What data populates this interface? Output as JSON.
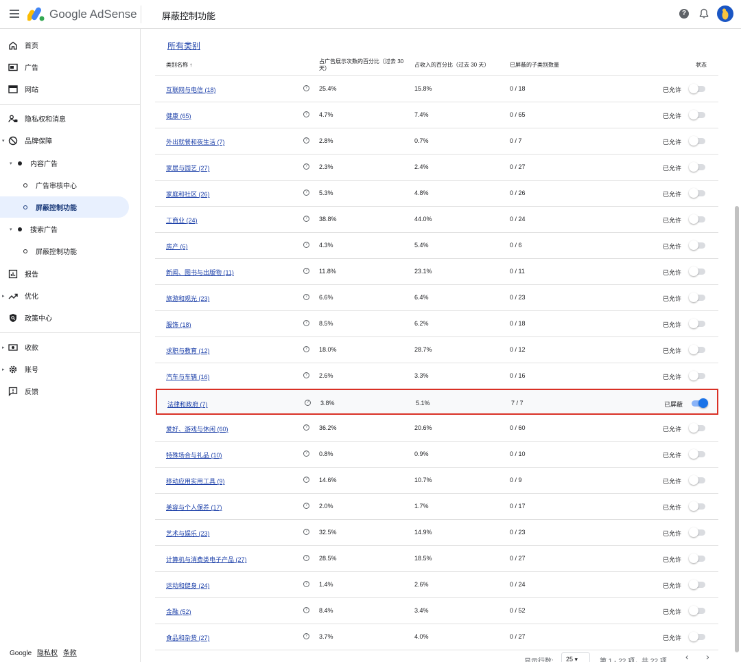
{
  "app": {
    "brand": "Google AdSense",
    "page_title": "屏蔽控制功能"
  },
  "header": {
    "help_label": "?"
  },
  "sidebar": {
    "items": [
      {
        "label": "首页"
      },
      {
        "label": "广告"
      },
      {
        "label": "网站"
      },
      {
        "label": "隐私权和消息"
      },
      {
        "label": "品牌保障"
      },
      {
        "label": "内容广告"
      },
      {
        "label": "广告审核中心"
      },
      {
        "label": "屏蔽控制功能"
      },
      {
        "label": "搜索广告"
      },
      {
        "label": "屏蔽控制功能"
      },
      {
        "label": "报告"
      },
      {
        "label": "优化"
      },
      {
        "label": "政策中心"
      },
      {
        "label": "收款"
      },
      {
        "label": "账号"
      },
      {
        "label": "反馈"
      }
    ],
    "footer": {
      "google": "Google",
      "privacy": "隐私权",
      "terms": "条款"
    }
  },
  "main": {
    "section_link": "所有类别",
    "columns": {
      "name": "类别名称 ↑",
      "impressions_line1": "占广告展示次数的百分比（过去 30",
      "impressions_line2": "天）",
      "revenue": "占收入的百分比（过去 30 天）",
      "blocked_subcats": "已屏蔽的子类别数量",
      "status": "状态"
    },
    "rows": [
      {
        "name": "互联网与电信 (18)",
        "impressions": "25.4%",
        "revenue": "15.8%",
        "blocked": "0 / 18",
        "status": "已允许",
        "on": false
      },
      {
        "name": "健康 (65)",
        "impressions": "4.7%",
        "revenue": "7.4%",
        "blocked": "0 / 65",
        "status": "已允许",
        "on": false
      },
      {
        "name": "外出就餐和夜生活 (7)",
        "impressions": "2.8%",
        "revenue": "0.7%",
        "blocked": "0 / 7",
        "status": "已允许",
        "on": false
      },
      {
        "name": "家居与园艺 (27)",
        "impressions": "2.3%",
        "revenue": "2.4%",
        "blocked": "0 / 27",
        "status": "已允许",
        "on": false
      },
      {
        "name": "家庭和社区 (26)",
        "impressions": "5.3%",
        "revenue": "4.8%",
        "blocked": "0 / 26",
        "status": "已允许",
        "on": false
      },
      {
        "name": "工商业 (24)",
        "impressions": "38.8%",
        "revenue": "44.0%",
        "blocked": "0 / 24",
        "status": "已允许",
        "on": false
      },
      {
        "name": "房产 (6)",
        "impressions": "4.3%",
        "revenue": "5.4%",
        "blocked": "0 / 6",
        "status": "已允许",
        "on": false
      },
      {
        "name": "新闻、图书与出版物 (11)",
        "impressions": "11.8%",
        "revenue": "23.1%",
        "blocked": "0 / 11",
        "status": "已允许",
        "on": false
      },
      {
        "name": "旅游和观光 (23)",
        "impressions": "6.6%",
        "revenue": "6.4%",
        "blocked": "0 / 23",
        "status": "已允许",
        "on": false
      },
      {
        "name": "服饰 (18)",
        "impressions": "8.5%",
        "revenue": "6.2%",
        "blocked": "0 / 18",
        "status": "已允许",
        "on": false
      },
      {
        "name": "求职与教育 (12)",
        "impressions": "18.0%",
        "revenue": "28.7%",
        "blocked": "0 / 12",
        "status": "已允许",
        "on": false
      },
      {
        "name": "汽车与车辆 (16)",
        "impressions": "2.6%",
        "revenue": "3.3%",
        "blocked": "0 / 16",
        "status": "已允许",
        "on": false
      },
      {
        "name": "法律和政府 (7)",
        "impressions": "3.8%",
        "revenue": "5.1%",
        "blocked": "7 / 7",
        "status": "已屏蔽",
        "on": true
      },
      {
        "name": "爱好、游戏与休闲 (60)",
        "impressions": "36.2%",
        "revenue": "20.6%",
        "blocked": "0 / 60",
        "status": "已允许",
        "on": false
      },
      {
        "name": "特殊场合与礼品 (10)",
        "impressions": "0.8%",
        "revenue": "0.9%",
        "blocked": "0 / 10",
        "status": "已允许",
        "on": false
      },
      {
        "name": "移动应用实用工具 (9)",
        "impressions": "14.6%",
        "revenue": "10.7%",
        "blocked": "0 / 9",
        "status": "已允许",
        "on": false
      },
      {
        "name": "美容与个人保养 (17)",
        "impressions": "2.0%",
        "revenue": "1.7%",
        "blocked": "0 / 17",
        "status": "已允许",
        "on": false
      },
      {
        "name": "艺术与娱乐 (23)",
        "impressions": "32.5%",
        "revenue": "14.9%",
        "blocked": "0 / 23",
        "status": "已允许",
        "on": false
      },
      {
        "name": "计算机与消费类电子产品 (27)",
        "impressions": "28.5%",
        "revenue": "18.5%",
        "blocked": "0 / 27",
        "status": "已允许",
        "on": false
      },
      {
        "name": "运动和健身 (24)",
        "impressions": "1.4%",
        "revenue": "2.6%",
        "blocked": "0 / 24",
        "status": "已允许",
        "on": false
      },
      {
        "name": "金融 (52)",
        "impressions": "8.4%",
        "revenue": "3.4%",
        "blocked": "0 / 52",
        "status": "已允许",
        "on": false
      },
      {
        "name": "食品和杂货 (27)",
        "impressions": "3.7%",
        "revenue": "4.0%",
        "blocked": "0 / 27",
        "status": "已允许",
        "on": false
      }
    ],
    "pager": {
      "rows_label": "显示行数:",
      "rows_value": "25 ▾",
      "range": "第 1 - 22 项，共 22 项",
      "prev": "‹",
      "next": "›"
    }
  },
  "colors": {
    "accent": "#1a73e8",
    "link": "#1a3ea8",
    "highlight_border": "#d93025"
  }
}
